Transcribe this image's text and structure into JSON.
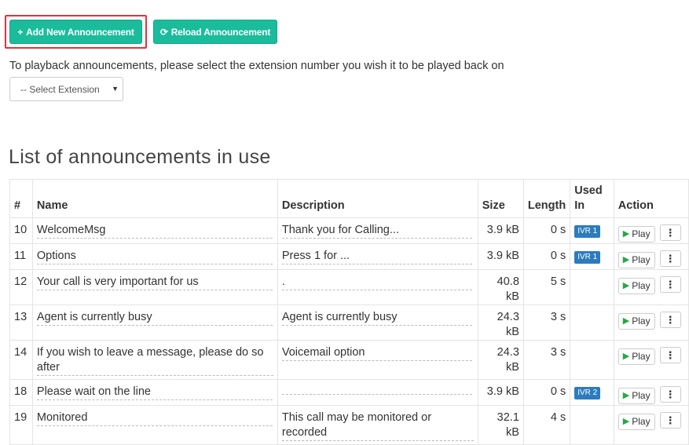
{
  "toolbar": {
    "add_label": "Add New Announcement",
    "reload_label": "Reload Announcement",
    "highlight_color": "#e8303c",
    "button_color": "#1abc9c"
  },
  "playback_hint": "To playback announcements, please select the extension number you wish it to be played back on",
  "extension_select": {
    "selected": "-- Select Extension"
  },
  "list_title": "List of announcements in use",
  "table": {
    "headers": {
      "num": "#",
      "name": "Name",
      "description": "Description",
      "size": "Size",
      "length": "Length",
      "used_in_1": "Used",
      "used_in_2": "In",
      "action": "Action"
    },
    "play_label": "Play",
    "rows": [
      {
        "num": "10",
        "name": "WelcomeMsg",
        "description": "Thank you for Calling...",
        "size": "3.9 kB",
        "length": "0 s",
        "used_in": "IVR 1"
      },
      {
        "num": "11",
        "name": "Options",
        "description": "Press 1 for ...",
        "size": "3.9 kB",
        "length": "0 s",
        "used_in": "IVR 1"
      },
      {
        "num": "12",
        "name": "Your call is very important for us",
        "description": ".",
        "size": "40.8 kB",
        "length": "5 s",
        "used_in": ""
      },
      {
        "num": "13",
        "name": "Agent is currently busy",
        "description": "Agent is currently busy",
        "size": "24.3 kB",
        "length": "3 s",
        "used_in": ""
      },
      {
        "num": "14",
        "name": "If you wish to leave a message, please do so after",
        "description": "Voicemail option",
        "size": "24.3 kB",
        "length": "3 s",
        "used_in": ""
      },
      {
        "num": "18",
        "name": "Please wait on the line",
        "description": "",
        "size": "3.9 kB",
        "length": "0 s",
        "used_in": "IVR 2"
      },
      {
        "num": "19",
        "name": "Monitored",
        "description": "This call may be monitored or recorded",
        "size": "32.1 kB",
        "length": "4 s",
        "used_in": ""
      }
    ]
  }
}
